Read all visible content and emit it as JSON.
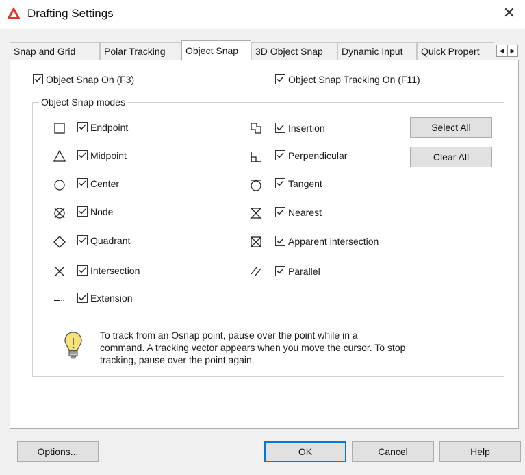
{
  "window": {
    "title": "Drafting Settings",
    "close_icon": "close-icon",
    "app_icon_color": "#e0372b"
  },
  "tabs": [
    {
      "label": "Snap and Grid",
      "active": false
    },
    {
      "label": "Polar Tracking",
      "active": false
    },
    {
      "label": "Object Snap",
      "active": true
    },
    {
      "label": "3D Object Snap",
      "active": false
    },
    {
      "label": "Dynamic Input",
      "active": false
    },
    {
      "label": "Quick Propert",
      "active": false
    }
  ],
  "tab_scroll": {
    "left": "◀",
    "right": "▶"
  },
  "top_options": {
    "object_snap_on": {
      "label": "Object Snap On (F3)",
      "checked": true
    },
    "object_snap_tracking_on": {
      "label": "Object Snap Tracking On (F11)",
      "checked": true
    }
  },
  "modes_group": {
    "title": "Object Snap modes",
    "left": [
      {
        "label": "Endpoint",
        "icon": "square-icon",
        "checked": true
      },
      {
        "label": "Midpoint",
        "icon": "triangle-icon",
        "checked": true
      },
      {
        "label": "Center",
        "icon": "circle-icon",
        "checked": true
      },
      {
        "label": "Node",
        "icon": "node-icon",
        "checked": true
      },
      {
        "label": "Quadrant",
        "icon": "diamond-icon",
        "checked": true
      },
      {
        "label": "Intersection",
        "icon": "x-icon",
        "checked": true
      },
      {
        "label": "Extension",
        "icon": "extension-icon",
        "checked": true
      }
    ],
    "right": [
      {
        "label": "Insertion",
        "icon": "insertion-icon",
        "checked": true
      },
      {
        "label": "Perpendicular",
        "icon": "perpendicular-icon",
        "checked": true
      },
      {
        "label": "Tangent",
        "icon": "tangent-icon",
        "checked": true
      },
      {
        "label": "Nearest",
        "icon": "hourglass-icon",
        "checked": true
      },
      {
        "label": "Apparent intersection",
        "icon": "boxed-x-icon",
        "checked": true
      },
      {
        "label": "Parallel",
        "icon": "parallel-icon",
        "checked": true
      }
    ],
    "select_all_label": "Select All",
    "clear_all_label": "Clear All"
  },
  "tip": {
    "icon": "lightbulb-icon",
    "lines": [
      "To track from an Osnap point, pause over the point while in a",
      "command.  A tracking vector appears when you move the cursor.  To stop",
      "tracking, pause over the point again."
    ]
  },
  "footer": {
    "options_label": "Options...",
    "ok_label": "OK",
    "cancel_label": "Cancel",
    "help_label": "Help"
  }
}
